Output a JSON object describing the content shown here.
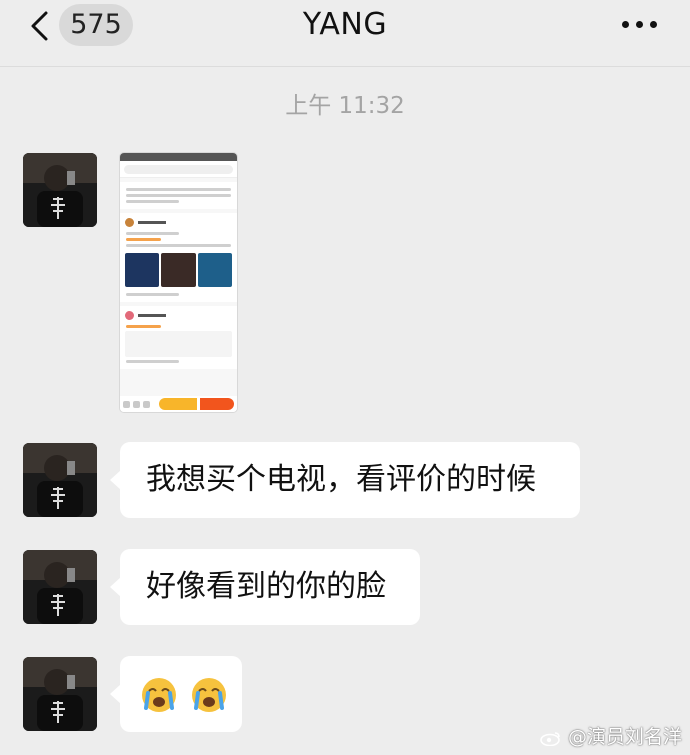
{
  "header": {
    "unread_count": "575",
    "title": "YANG"
  },
  "timestamp": "上午 11:32",
  "messages": [
    {
      "type": "image"
    },
    {
      "type": "text",
      "text": "我想买个电视，看评价的时候"
    },
    {
      "type": "text",
      "text": "好像看到的你的脸"
    },
    {
      "type": "emoji",
      "emoji": [
        "crying-face",
        "crying-face"
      ]
    }
  ],
  "watermark": "@演员刘名洋"
}
